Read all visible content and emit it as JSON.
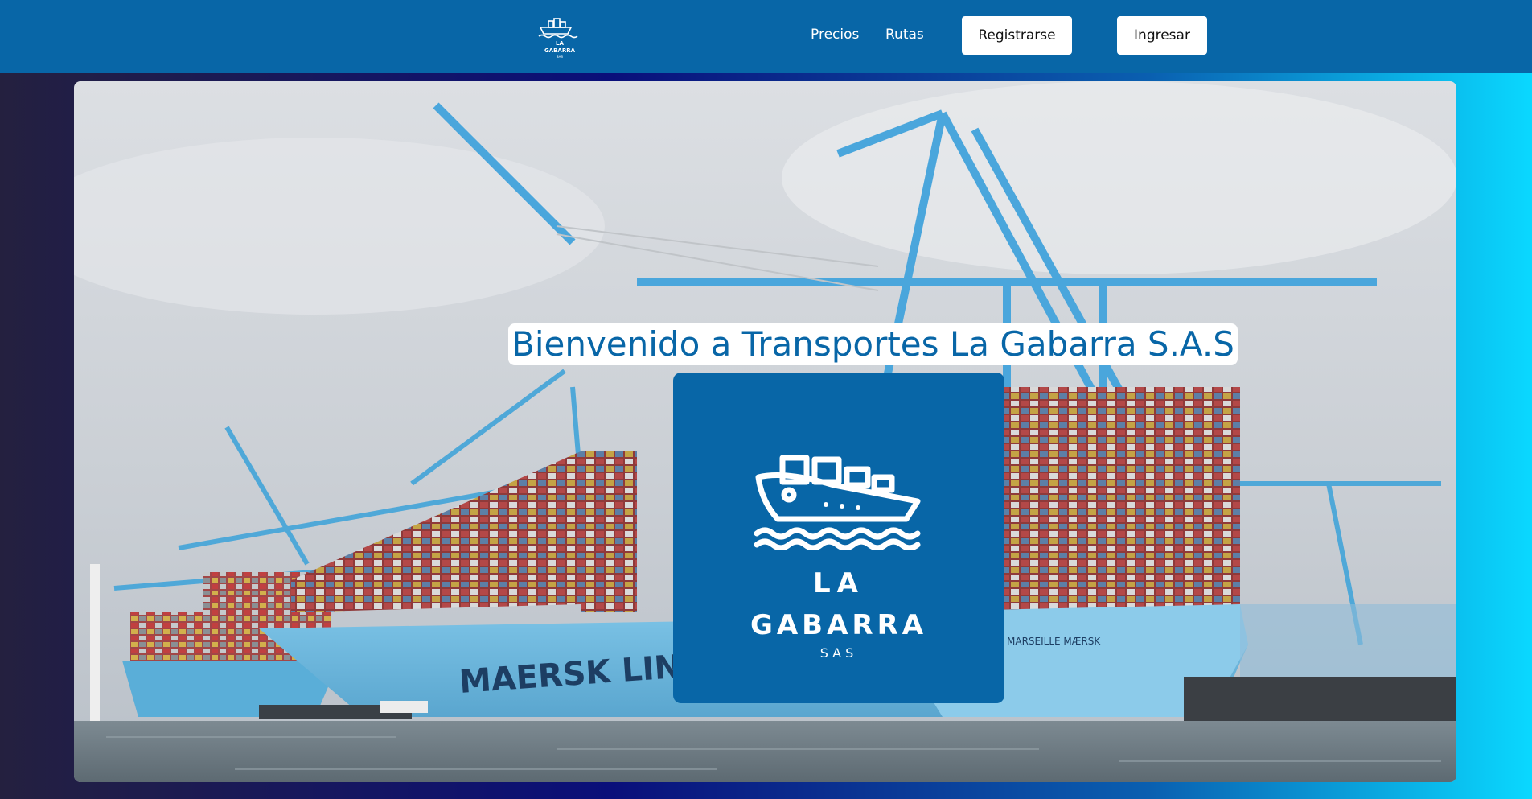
{
  "header": {
    "brand": {
      "line1": "LA",
      "line2": "GABARRA",
      "line3": "SAS",
      "icon": "ship-icon"
    },
    "nav": [
      {
        "label": "Precios"
      },
      {
        "label": "Rutas"
      }
    ],
    "register_label": "Registrarse",
    "login_label": "Ingresar"
  },
  "hero": {
    "welcome_text": "Bienvenido a Transportes La Gabarra S.A.S",
    "image": "container-ship-port-photo",
    "logo": {
      "line1": "LA",
      "line2": "GABARRA",
      "line3": "SAS",
      "icon": "ship-icon"
    }
  },
  "colors": {
    "primary": "#0866a7",
    "button_bg": "#ffffff",
    "gradient_left": "#24203f",
    "gradient_right": "#0ad8ff"
  }
}
